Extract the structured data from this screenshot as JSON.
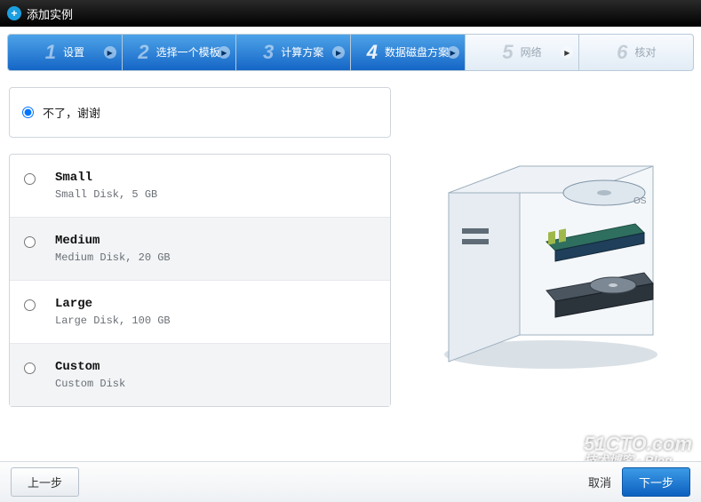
{
  "header": {
    "title": "添加实例"
  },
  "steps": {
    "items": [
      {
        "num": "1",
        "label": "设置"
      },
      {
        "num": "2",
        "label": "选择一个模板"
      },
      {
        "num": "3",
        "label": "计算方案"
      },
      {
        "num": "4",
        "label": "数据磁盘方案"
      },
      {
        "num": "5",
        "label": "网络"
      },
      {
        "num": "6",
        "label": "核对"
      }
    ]
  },
  "no_thanks": {
    "label": "不了，谢谢"
  },
  "disk_options": [
    {
      "title": "Small",
      "desc": "Small Disk, 5 GB"
    },
    {
      "title": "Medium",
      "desc": "Medium Disk, 20 GB"
    },
    {
      "title": "Large",
      "desc": "Large Disk, 100 GB"
    },
    {
      "title": "Custom",
      "desc": "Custom Disk"
    }
  ],
  "illustration": {
    "os_label": "OS"
  },
  "footer": {
    "prev": "上一步",
    "cancel": "取消",
    "next": "下一步"
  },
  "watermark": {
    "line1": "51CTO.com",
    "line2": "技术博客 - Blog"
  }
}
